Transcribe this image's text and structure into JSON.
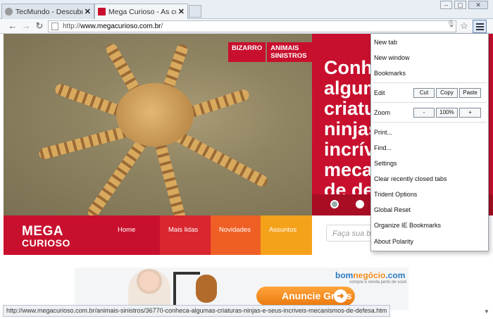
{
  "browser": {
    "tabs": [
      {
        "title": "TecMundo - Descubra",
        "favicon_color": "#9a9a9a",
        "close": "✕"
      },
      {
        "title": "Mega Curioso - As curi",
        "favicon_color": "#c8102e",
        "close": "✕"
      }
    ],
    "window_controls": [
      "‒",
      "▢",
      "✕"
    ],
    "nav": {
      "back": "←",
      "forward": "→",
      "reload": "↻"
    },
    "url_scheme": "http://",
    "url_host": "www.megacurioso.com.br",
    "url_path": "/",
    "status_url": "http://www.megacurioso.com.br/animais-sinistros/36770-conheca-algumas-criaturas-ninjas-e-seus-incriveis-mecanismos-de-defesa.htm"
  },
  "page": {
    "tags": [
      "BIZARRO",
      "ANIMAIS SINISTROS",
      "»"
    ],
    "hero_title": "Conhe\nalgum\ncriatu\nninjas\nincrív\nmeca\nde def",
    "logo_line1": "MEGA",
    "logo_line2": "CURIOSO",
    "nav_items": [
      {
        "label": "Home",
        "color": "#c8102e"
      },
      {
        "label": "Mais lidas",
        "color": "#d9262f"
      },
      {
        "label": "Novidades",
        "color": "#ef5f25"
      },
      {
        "label": "Assuntos",
        "color": "#f5a21b"
      }
    ],
    "search_placeholder": "Faça sua b",
    "ad": {
      "brand_a": "bom",
      "brand_b": "negócio",
      "brand_c": ".com",
      "sub": "compre e venda perto de você",
      "cta": "Anuncie Grátis"
    }
  },
  "menu": {
    "items_top": [
      "New tab",
      "New window",
      "Bookmarks"
    ],
    "edit_label": "Edit",
    "edit_buttons": [
      "Cut",
      "Copy",
      "Paste"
    ],
    "zoom_label": "Zoom",
    "zoom_minus": "-",
    "zoom_value": "100%",
    "zoom_plus": "+",
    "items_bottom": [
      "Print...",
      "Find...",
      "Settings",
      "Clear recently closed tabs",
      "Trident Options",
      "Global Reset",
      "Organize IE Bookmarks",
      "About Polarity"
    ]
  }
}
